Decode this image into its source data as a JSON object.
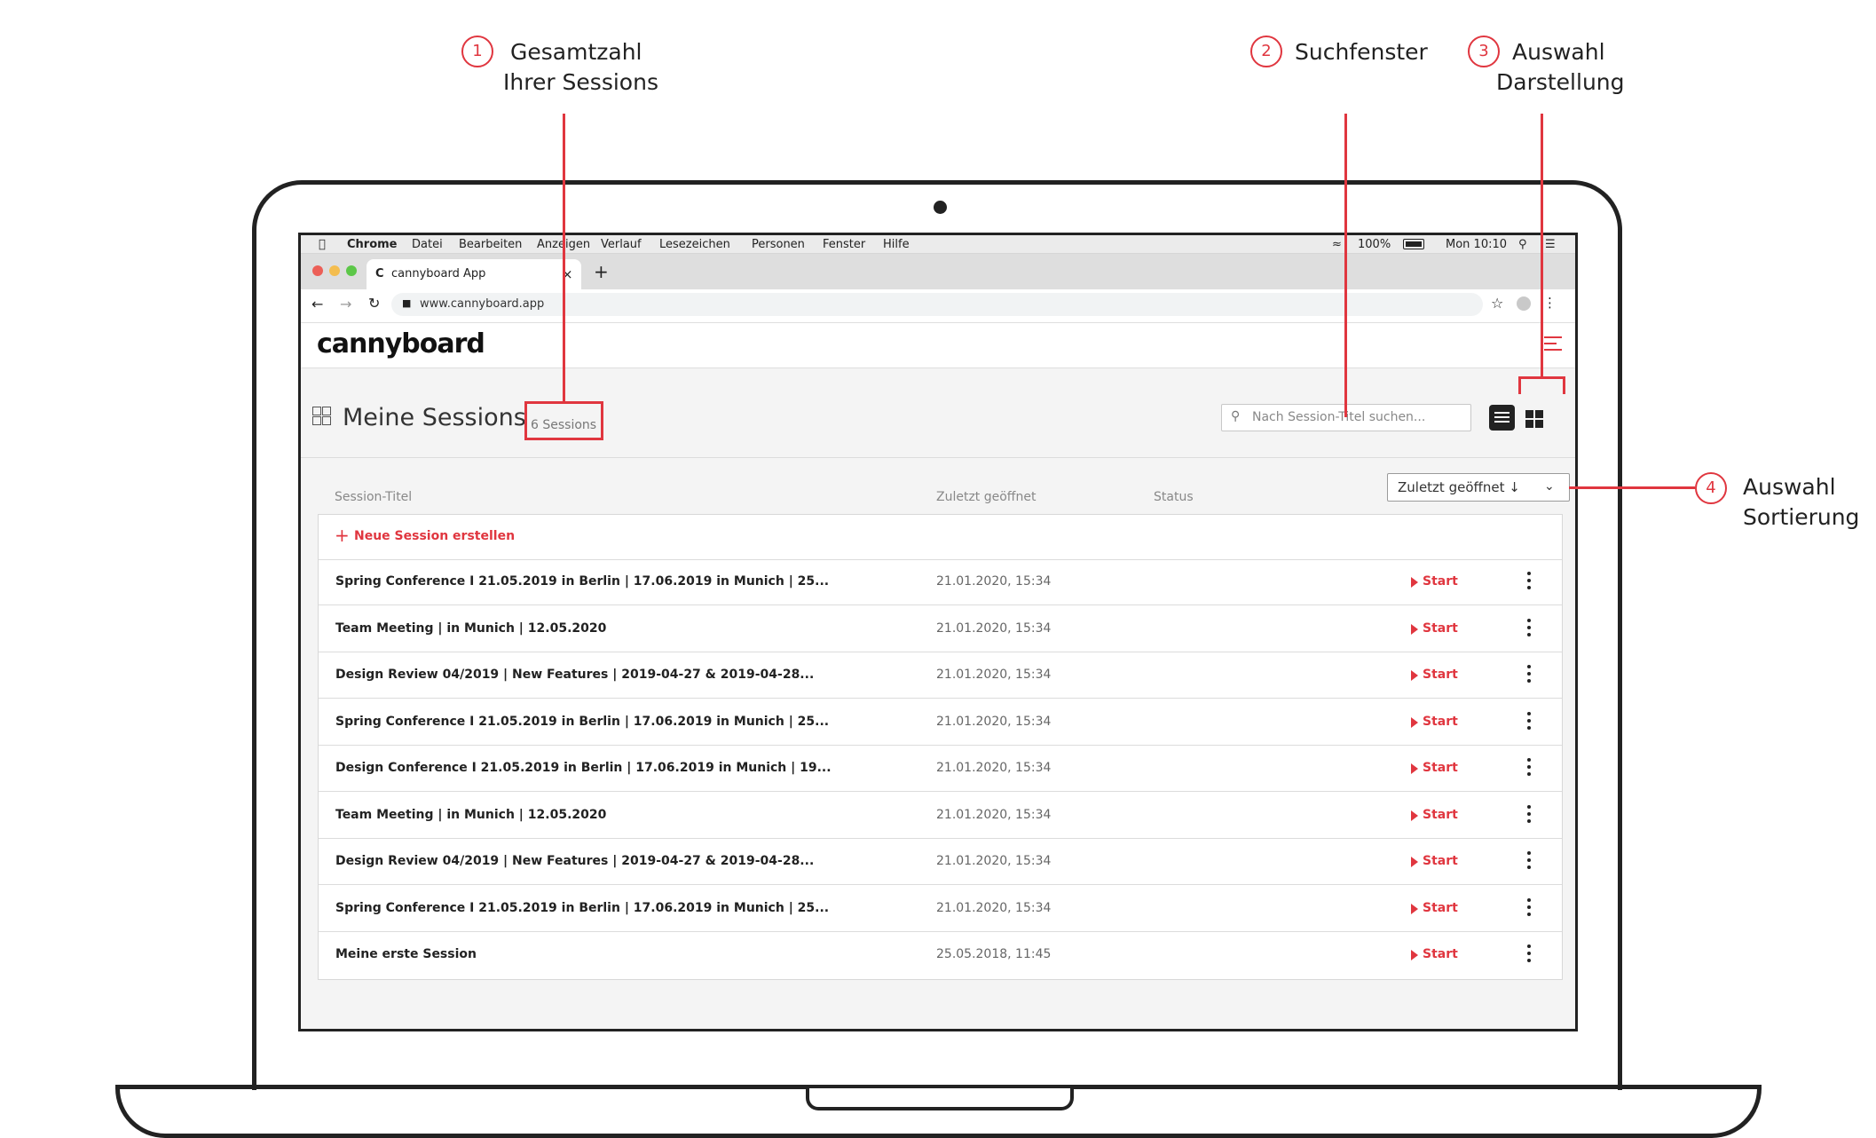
{
  "annotations": [
    {
      "number": "1",
      "line1": "Gesamtzahl",
      "line2": "Ihrer Sessions"
    },
    {
      "number": "2",
      "line1": "Suchfenster",
      "line2": ""
    },
    {
      "number": "3",
      "line1": "Auswahl",
      "line2": "Darstellung"
    },
    {
      "number": "4",
      "line1": "Auswahl",
      "line2": "Sortierung"
    }
  ],
  "menubar": {
    "app": "Chrome",
    "items": [
      "Datei",
      "Bearbeiten",
      "Anzeigen",
      "Verlauf",
      "Lesezeichen",
      "Personen",
      "Fenster",
      "Hilfe"
    ],
    "battery": "100%",
    "clock": "Mon 10:10"
  },
  "browser": {
    "tab_title": "cannyboard App",
    "tab_favicon": "C",
    "url": "www.cannyboard.app"
  },
  "app": {
    "logo": "cannyboard",
    "page_title": "Meine Sessions",
    "session_count": "6 Sessions",
    "search_placeholder": "Nach Session-Titel suchen...",
    "sort_label": "Zuletzt geöffnet ↓"
  },
  "table": {
    "columns": [
      "Session-Titel",
      "Zuletzt geöffnet",
      "Status"
    ],
    "new_session": "Neue Session erstellen",
    "start_label": "Start",
    "rows": [
      {
        "title": "Spring Conference I 21.05.2019 in Berlin | 17.06.2019 in Munich | 25...",
        "date": "21.01.2020, 15:34"
      },
      {
        "title": "Team Meeting | in Munich | 12.05.2020",
        "date": "21.01.2020, 15:34"
      },
      {
        "title": "Design Review 04/2019 | New Features | 2019-04-27 & 2019-04-28...",
        "date": "21.01.2020, 15:34"
      },
      {
        "title": "Spring Conference I 21.05.2019 in Berlin | 17.06.2019 in Munich | 25...",
        "date": "21.01.2020, 15:34"
      },
      {
        "title": "Design Conference I 21.05.2019 in Berlin | 17.06.2019 in Munich | 19...",
        "date": "21.01.2020, 15:34"
      },
      {
        "title": "Team Meeting | in Munich | 12.05.2020",
        "date": "21.01.2020, 15:34"
      },
      {
        "title": "Design Review 04/2019 | New Features | 2019-04-27 & 2019-04-28...",
        "date": "21.01.2020, 15:34"
      },
      {
        "title": "Spring Conference I 21.05.2019 in Berlin | 17.06.2019 in Munich | 25...",
        "date": "21.01.2020, 15:34"
      },
      {
        "title": "Meine erste Session",
        "date": "25.05.2018, 11:45"
      }
    ]
  },
  "colors": {
    "accent": "#e0363f"
  }
}
